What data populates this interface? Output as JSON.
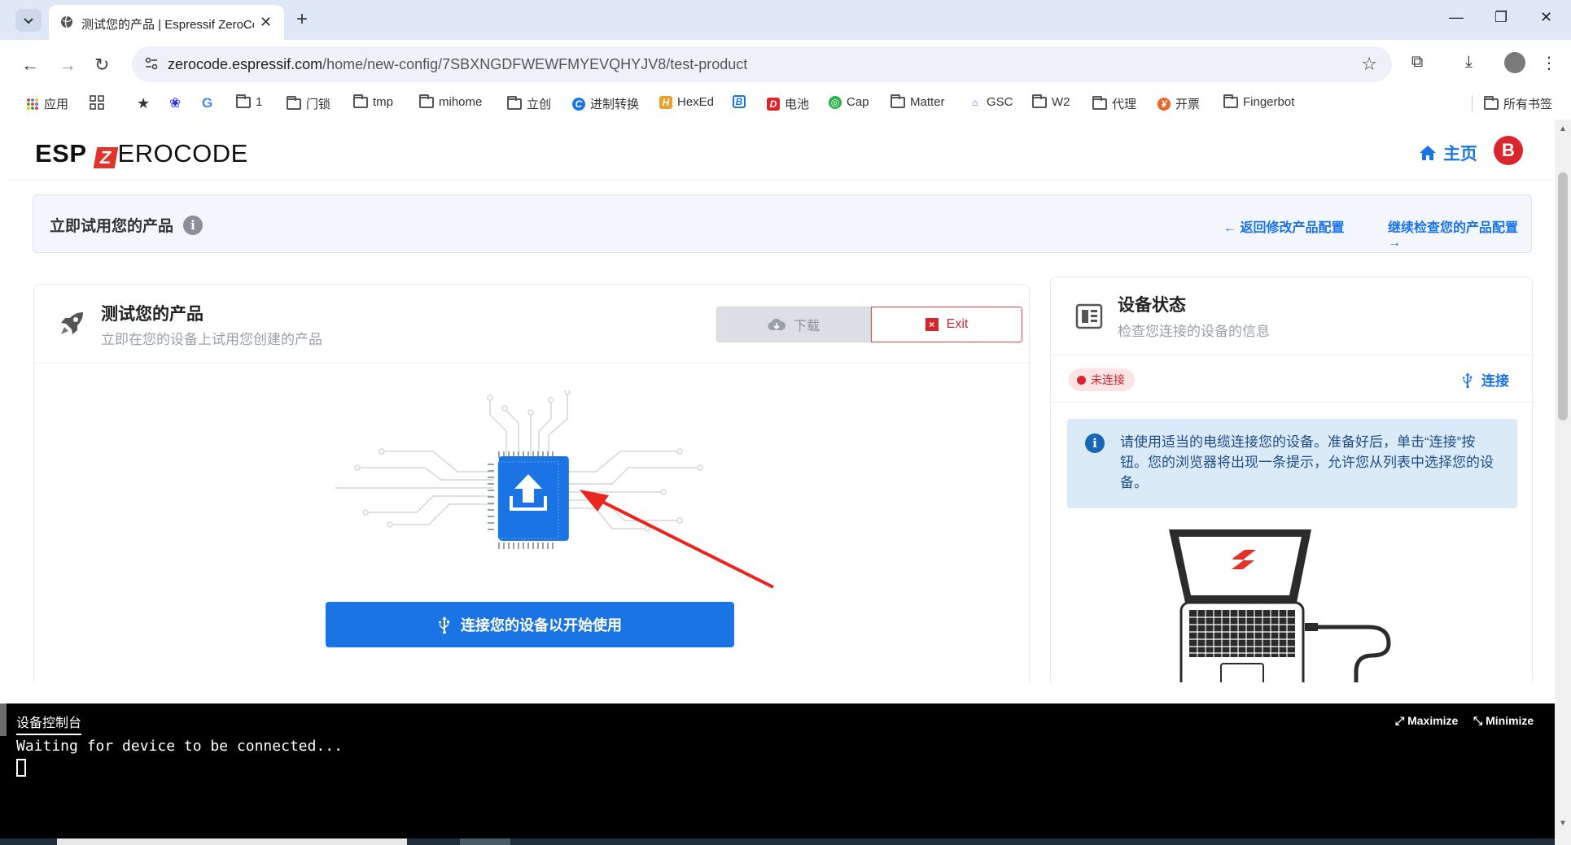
{
  "browser": {
    "tab_title": "测试您的产品 | Espressif ZeroCode",
    "url_host": "zerocode.espressif.com",
    "url_path": "/home/new-config/7SBXNGDFWEWFMYEVQHYJV8/test-product",
    "icons": [
      "tab-search-icon",
      "globe-icon",
      "close-icon",
      "plus-icon",
      "minimize-icon",
      "restore-icon",
      "window-close-icon",
      "back-icon",
      "forward-icon",
      "reload-icon",
      "site-settings-icon",
      "star-icon",
      "extensions-icon",
      "download-icon",
      "menu-icon"
    ]
  },
  "bookmarks": {
    "items": [
      {
        "label": "应用",
        "icon": "apps-grid-icon"
      },
      {
        "label": "",
        "icon": "grid-icon"
      },
      {
        "label": "",
        "icon": "star-icon"
      },
      {
        "label": "",
        "icon": "baidu-icon"
      },
      {
        "label": "",
        "icon": "google-icon"
      },
      {
        "label": "1",
        "icon": "folder-icon"
      },
      {
        "label": "门锁",
        "icon": "folder-icon"
      },
      {
        "label": "tmp",
        "icon": "folder-icon"
      },
      {
        "label": "mihome",
        "icon": "folder-icon"
      },
      {
        "label": "立创",
        "icon": "folder-icon"
      },
      {
        "label": "进制转换",
        "icon": "c-icon"
      },
      {
        "label": "HexEd",
        "icon": "hexed-icon"
      },
      {
        "label": "",
        "icon": "b-icon"
      },
      {
        "label": "电池",
        "icon": "battery-d-icon"
      },
      {
        "label": "Cap",
        "icon": "cap-icon"
      },
      {
        "label": "Matter",
        "icon": "folder-icon"
      },
      {
        "label": "GSC",
        "icon": "gsc-icon"
      },
      {
        "label": "W2",
        "icon": "folder-icon"
      },
      {
        "label": "代理",
        "icon": "folder-icon"
      },
      {
        "label": "开票",
        "icon": "invoice-icon"
      },
      {
        "label": "Fingerbot",
        "icon": "folder-icon"
      }
    ],
    "all_bookmarks": "所有书签"
  },
  "site": {
    "logo_bold": "ESP",
    "logo_z": "Z",
    "logo_rest": "EROCODE",
    "home_label": "主页",
    "user_initial": "B"
  },
  "banner": {
    "title": "立即试用您的产品",
    "info": "i",
    "back_label": "← 返回修改产品配置",
    "forward_label": "继续检查您的产品配置 →"
  },
  "test_card": {
    "title": "测试您的产品",
    "subtitle": "立即在您的设备上试用您创建的产品",
    "download_label": "下载",
    "exit_label": "Exit",
    "exit_x": "×",
    "connect_button": "连接您的设备以开始使用"
  },
  "status_card": {
    "title": "设备状态",
    "subtitle": "检查您连接的设备的信息",
    "status_badge": "未连接",
    "connect_label": "连接",
    "info": "i",
    "info_text": "请使用适当的电缆连接您的设备。准备好后，单击“连接”按钮。您的浏览器将出现一条提示，允许您从列表中选择您的设备。"
  },
  "console": {
    "tab_label": "设备控制台",
    "maximize_label": "⤢ Maximize",
    "minimize_label": "⤡ Minimize",
    "log": "Waiting for device to be connected..."
  },
  "colors": {
    "accent": "#1b74e4",
    "danger": "#d6252d",
    "info_bg": "#dbeaf7",
    "console_bg": "#000000"
  }
}
